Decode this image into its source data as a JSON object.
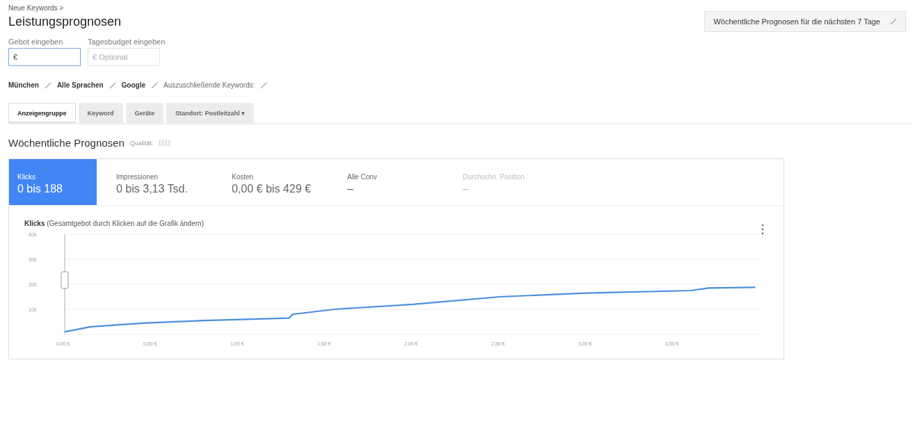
{
  "breadcrumb": "Neue Keywords >",
  "title": "Leistungsprognosen",
  "period_button": {
    "label": "Wöchentliche Prognosen für die nächsten 7 Tage"
  },
  "fields": [
    {
      "label": "Gebot eingeben",
      "value": "€",
      "focused": true
    },
    {
      "label": "Tagesbudget eingeben",
      "placeholder": "€ Optional",
      "focused": false
    }
  ],
  "filters": [
    {
      "label": "München",
      "kind": "value"
    },
    {
      "label": "Alle Sprachen",
      "kind": "value"
    },
    {
      "label": "Google",
      "kind": "value"
    },
    {
      "label": "Auszuschließende Keywords:",
      "kind": "prompt"
    }
  ],
  "tabs": [
    {
      "label": "Anzeigengruppe",
      "selected": true
    },
    {
      "label": "Keyword",
      "selected": false
    },
    {
      "label": "Geräte",
      "selected": false
    },
    {
      "label": "Standort: Postleitzahl ▾",
      "selected": false
    }
  ],
  "section": {
    "title": "Wöchentliche Prognosen",
    "quality_label": "Qualität:"
  },
  "metrics": [
    {
      "label": "Klicks",
      "value": "0 bis 188",
      "selected": true,
      "disabled": false
    },
    {
      "label": "Impressionen",
      "value": "0 bis 3,13 Tsd.",
      "selected": false,
      "disabled": false
    },
    {
      "label": "Kosten",
      "value": "0,00 € bis 429 €",
      "selected": false,
      "disabled": false
    },
    {
      "label": "Alle Conv",
      "value": "–",
      "selected": false,
      "disabled": false
    },
    {
      "label": "Durchschn. Position",
      "value": "–",
      "selected": false,
      "disabled": true
    }
  ],
  "chart": {
    "title": "**Klicks** (Gesamtgebot durch Klicken auf die Grafik ändern)",
    "chart_data": {
      "type": "line",
      "x": [
        0,
        0.15,
        0.45,
        0.8,
        1.29,
        1.31,
        1.55,
        2.0,
        2.5,
        3.0,
        3.6,
        3.7,
        3.97
      ],
      "series": [
        {
          "color": "#4a8ee0",
          "values": [
            10,
            30,
            45,
            55,
            65,
            80,
            100,
            120,
            150,
            165,
            175,
            185,
            188
          ]
        }
      ],
      "xlim": [
        0,
        4
      ],
      "ylim": [
        0,
        400
      ],
      "grid": true,
      "xticks": [
        {
          "value": 0,
          "label": "0,00 €"
        },
        {
          "value": 0.5,
          "label": "0,50 €"
        },
        {
          "value": 1,
          "label": "1,00 €"
        },
        {
          "value": 1.5,
          "label": "1,50 €"
        },
        {
          "value": 2,
          "label": "2,00 €"
        },
        {
          "value": 2.5,
          "label": "2,50 €"
        },
        {
          "value": 3,
          "label": "3,00 €"
        },
        {
          "value": 3.5,
          "label": "3,50 €"
        }
      ],
      "yticks": [
        100,
        200,
        300,
        400
      ]
    }
  }
}
